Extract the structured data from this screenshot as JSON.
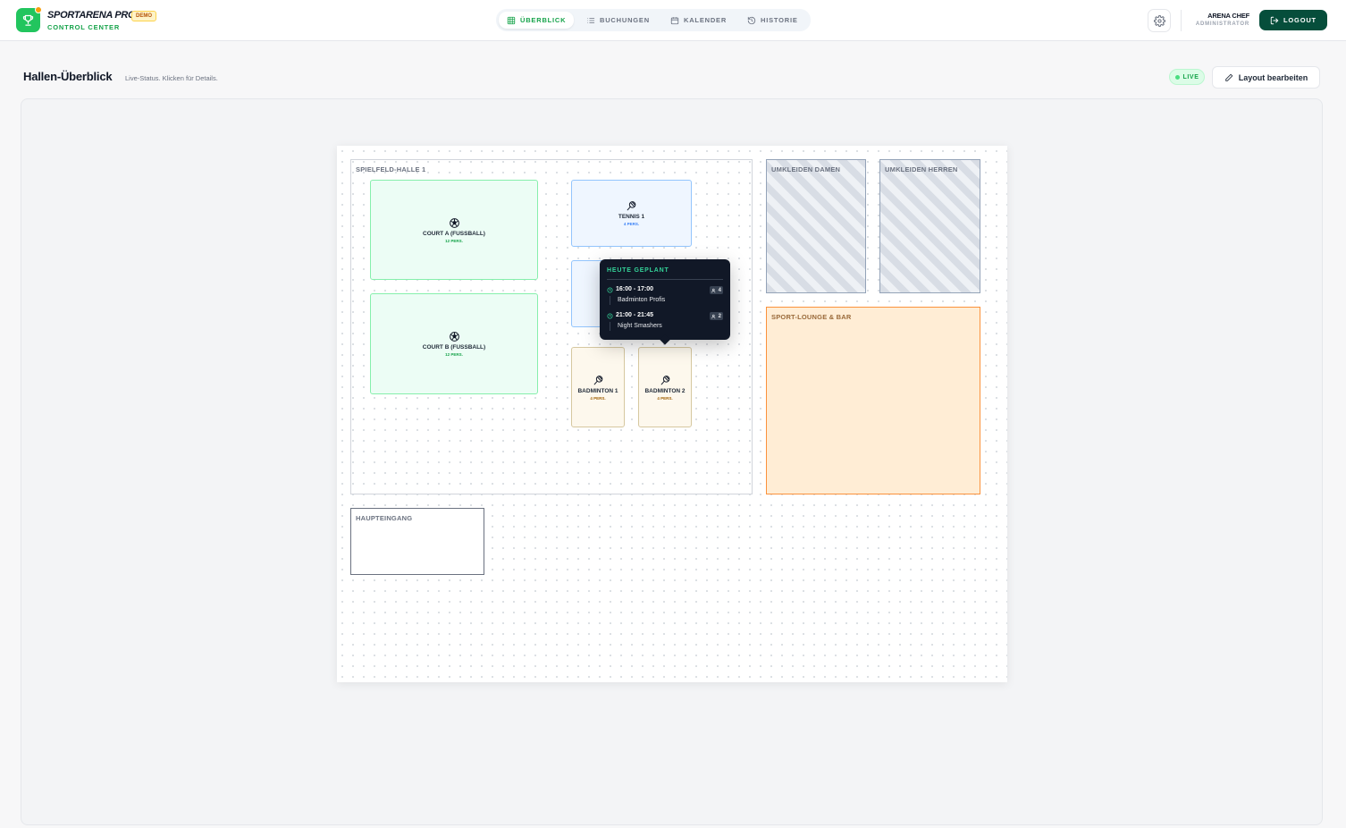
{
  "brand": {
    "name": "SPORTARENA PRO",
    "badge": "DEMO",
    "subtitle": "CONTROL CENTER",
    "logo_icon": "trophy-icon",
    "accent": "#22c55e"
  },
  "nav": {
    "items": [
      {
        "label": "ÜBERBLICK",
        "icon": "grid-icon",
        "active": true
      },
      {
        "label": "BUCHUNGEN",
        "icon": "list-icon",
        "active": false
      },
      {
        "label": "KALENDER",
        "icon": "calendar-icon",
        "active": false
      },
      {
        "label": "HISTORIE",
        "icon": "history-icon",
        "active": false
      }
    ]
  },
  "user": {
    "name": "ARENA CHEF",
    "role": "ADMINISTRATOR",
    "logout_label": "LOGOUT"
  },
  "page": {
    "title": "Hallen-Überblick",
    "subtitle": "Live-Status. Klicken für Details.",
    "live_label": "LIVE",
    "edit_label": "Layout bearbeiten"
  },
  "floorplan": {
    "zones": {
      "hall": "SPIELFELD-HALLE 1",
      "changing_women": "UMKLEIDEN DAMEN",
      "changing_men": "UMKLEIDEN HERREN",
      "lounge": "SPORT-LOUNGE & BAR",
      "entrance": "HAUPTEINGANG"
    },
    "courts": {
      "court_a": {
        "name": "COURT A (FUSSBALL)",
        "capacity": "12 PERS.",
        "icon": "soccer-ball-icon"
      },
      "court_b": {
        "name": "COURT B (FUSSBALL)",
        "capacity": "12 PERS.",
        "icon": "soccer-ball-icon"
      },
      "tennis_1": {
        "name": "TENNIS 1",
        "capacity": "4 PERS.",
        "icon": "racket-icon"
      },
      "badminton_1": {
        "name": "BADMINTON 1",
        "capacity": "4 PERS.",
        "icon": "racket-icon"
      },
      "badminton_2": {
        "name": "BADMINTON 2",
        "capacity": "4 PERS.",
        "icon": "racket-icon"
      }
    }
  },
  "tooltip": {
    "title": "HEUTE GEPLANT",
    "bookings": [
      {
        "time": "16:00 - 17:00",
        "team": "Badminton Profis",
        "persons": "4"
      },
      {
        "time": "21:00 - 21:45",
        "team": "Night Smashers",
        "persons": "2"
      }
    ]
  }
}
